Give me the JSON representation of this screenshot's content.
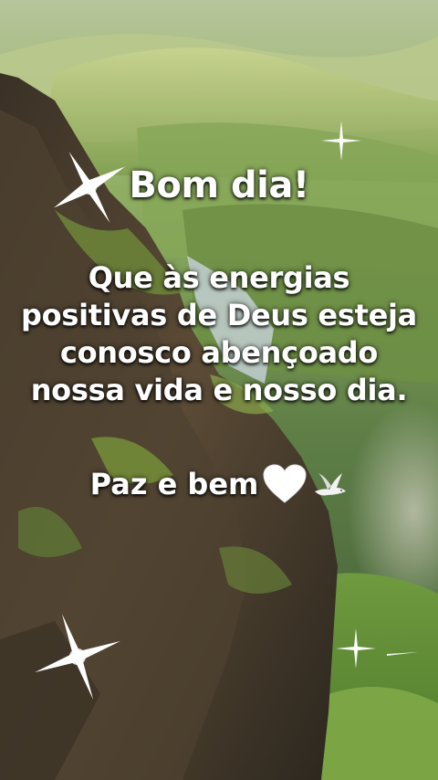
{
  "greeting": "Bom dia!",
  "message_lines": [
    "Que às energias",
    "positivas de Deus esteja",
    "conosco abençoado",
    "nossa vida e nosso dia."
  ],
  "closing": "Paz e bem",
  "decorations": {
    "heart_icon": "white-heart-icon",
    "dove_icon": "dove-icon",
    "sparkle_icon": "sparkle-icon"
  },
  "colors": {
    "text": "#ffffff",
    "grass_light": "#a9c46a",
    "grass_dark": "#3f6b2e",
    "rock": "#4a3f30"
  }
}
